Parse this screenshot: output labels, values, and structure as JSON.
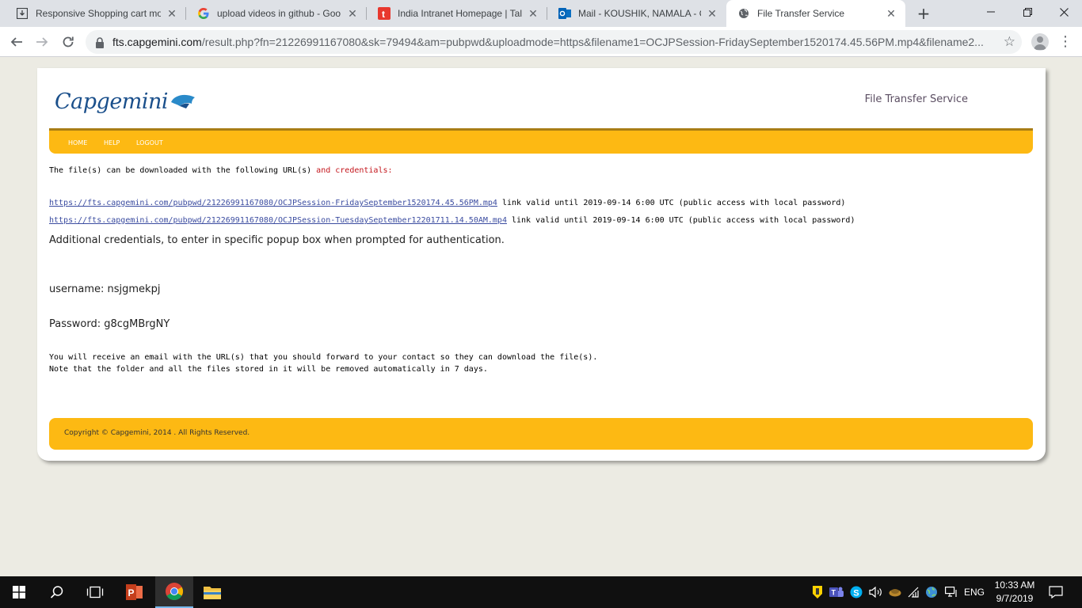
{
  "browser": {
    "tabs": [
      {
        "title": "Responsive Shopping cart moc",
        "icon": "download-page-icon"
      },
      {
        "title": "upload videos in github - Goo",
        "icon": "google-icon"
      },
      {
        "title": "India Intranet Homepage | Tale",
        "icon": "talent-icon"
      },
      {
        "title": "Mail - KOUSHIK, NAMALA - Ou",
        "icon": "outlook-icon"
      },
      {
        "title": "File Transfer Service",
        "icon": "globe-icon"
      }
    ],
    "url_host": "fts.capgemini.com",
    "url_rest": "/result.php?fn=21226991167080&sk=79494&am=pubpwd&uploadmode=https&filename1=OCJPSession-FridaySeptember1520174.45.56PM.mp4&filename2..."
  },
  "header": {
    "logo_text": "Capgemini",
    "service_title": "File Transfer Service"
  },
  "nav": {
    "home": "HOME",
    "help": "HELP",
    "logout": "LOGOUT"
  },
  "content": {
    "intro_prefix": "The file(s) can be downloaded with the following URL(s)",
    "intro_suffix": "and credentials:",
    "links": [
      {
        "url": "https://fts.capgemini.com/pubpwd/21226991167080/OCJPSession-FridaySeptember1520174.45.56PM.mp4",
        "note": "link valid until 2019-09-14 6:00 UTC (public access with local password)"
      },
      {
        "url": "https://fts.capgemini.com/pubpwd/21226991167080/OCJPSession-TuesdaySeptember12201711.14.50AM.mp4",
        "note": "link valid until 2019-09-14 6:00 UTC (public access with local password)"
      }
    ],
    "additional": "Additional credentials, to enter in specific popup box when prompted for authentication.",
    "username": "username: nsjgmekpj",
    "password": "Password: g8cgMBrgNY",
    "notice_1": "You will receive an email with the URL(s) that you should forward to your contact so they can download the file(s).",
    "notice_2": "Note that the folder and all the files stored in it will be removed automatically in 7 days."
  },
  "footer": {
    "copyright": "Copyright © Capgemini, 2014 . All Rights Reserved."
  },
  "taskbar": {
    "language": "ENG",
    "time": "10:33 AM",
    "date": "9/7/2019"
  },
  "colors": {
    "accent_yellow": "#fdb913",
    "brand_blue": "#1a4f8b",
    "link_blue": "#3b4ca0",
    "highlight_red": "#c4161c"
  }
}
